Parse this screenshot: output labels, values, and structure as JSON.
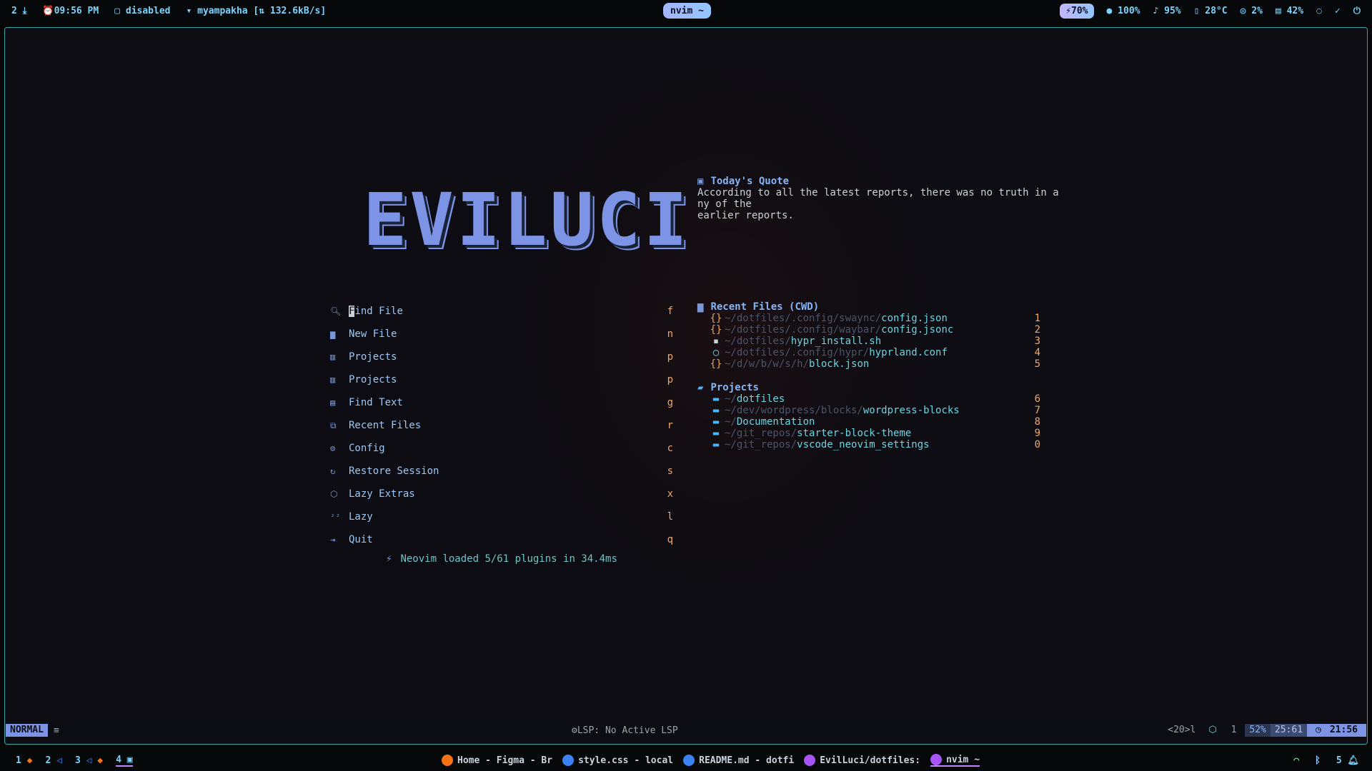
{
  "topbar": {
    "left": {
      "updates": "2 ⤓",
      "clock": "⏰09:56 PM",
      "idle": "disabled",
      "network": "myampakha [⇅ 132.6kB/s]"
    },
    "center_title": "nvim ~",
    "right": {
      "battery_pill": "70%",
      "brightness": "100%",
      "volume": "95%",
      "temp": "28°C",
      "cpu": "2%",
      "memory": "42%"
    }
  },
  "dashboard": {
    "logo_text": "EVILUCI",
    "menu": [
      {
        "label": "Find File",
        "key": "f",
        "icon": "search-icon"
      },
      {
        "label": "New File",
        "key": "n",
        "icon": "file-icon"
      },
      {
        "label": "Projects",
        "key": "p",
        "icon": "projects-icon"
      },
      {
        "label": "Projects",
        "key": "p",
        "icon": "projects-icon"
      },
      {
        "label": "Find Text",
        "key": "g",
        "icon": "text-search-icon"
      },
      {
        "label": "Recent Files",
        "key": "r",
        "icon": "recent-files-icon"
      },
      {
        "label": "Config",
        "key": "c",
        "icon": "gear-icon"
      },
      {
        "label": "Restore Session",
        "key": "s",
        "icon": "restore-icon"
      },
      {
        "label": "Lazy Extras",
        "key": "x",
        "icon": "box-icon"
      },
      {
        "label": "Lazy",
        "key": "l",
        "icon": "sleep-icon"
      },
      {
        "label": "Quit",
        "key": "q",
        "icon": "exit-icon"
      }
    ],
    "loaded_text": "Neovim loaded 5/61 plugins in 34.4ms",
    "quote": {
      "title": "Today's Quote",
      "line1": "According to all the latest reports, there was no truth in a",
      "line2": "ny of the",
      "line3": "earlier reports."
    },
    "recent": {
      "title": "Recent Files (CWD)",
      "items": [
        {
          "dir": "~/dotfiles/.config/swaync/",
          "file": "config.json",
          "num": "1"
        },
        {
          "dir": "~/dotfiles/.config/waybar/",
          "file": "config.jsonc",
          "num": "2"
        },
        {
          "dir": "~/dotfiles/",
          "file": "hypr_install.sh",
          "num": "3"
        },
        {
          "dir": "~/dotfiles/.config/hypr/",
          "file": "hyprland.conf",
          "num": "4"
        },
        {
          "dir": "~/d/w/b/w/s/h/",
          "file": "block.json",
          "num": "5"
        }
      ]
    },
    "projects": {
      "title": "Projects",
      "items": [
        {
          "dir": "~/",
          "file": "dotfiles",
          "num": "6"
        },
        {
          "dir": "~/dev/wordpress/blocks/",
          "file": "wordpress-blocks",
          "num": "7"
        },
        {
          "dir": "~/",
          "file": "Documentation",
          "num": "8"
        },
        {
          "dir": "~/git_repos/",
          "file": "starter-block-theme",
          "num": "9"
        },
        {
          "dir": "~/git_repos/",
          "file": "vscode_neovim_settings",
          "num": "0"
        }
      ]
    }
  },
  "statusline": {
    "mode": "NORMAL",
    "lsp": "LSP: No Active LSP",
    "keys": "<20>l",
    "count": "1",
    "percent": "52%",
    "position": "25:61",
    "time": "21:56"
  },
  "bottombar": {
    "workspaces": [
      "1",
      "2",
      "3",
      "4"
    ],
    "tasks": [
      {
        "label": "Home - Figma - Br",
        "color": "#f97316"
      },
      {
        "label": "style.css - local",
        "color": "#3b82f6"
      },
      {
        "label": "README.md - dotfi",
        "color": "#3b82f6"
      },
      {
        "label": "EvilLuci/dotfiles:",
        "color": "#a855f7"
      },
      {
        "label": "nvim ~",
        "color": "#a855f7"
      }
    ],
    "notif_count": "5"
  },
  "colors": {
    "accent": "#7c93e6",
    "teal": "#6dd4e0",
    "orange": "#f0a868"
  }
}
